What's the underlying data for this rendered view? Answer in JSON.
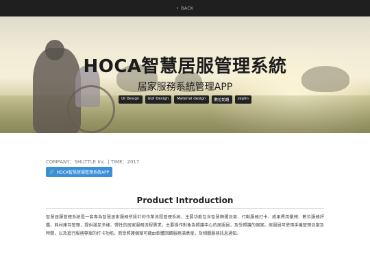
{
  "topbar": {
    "back_label": "BACK"
  },
  "hero": {
    "title": "HOCA智慧居服管理系統",
    "subtitle": "居家服務系統管理APP",
    "tags": [
      "UI Design",
      "GUI Design",
      "Material design",
      "數位訪題",
      "zeplin"
    ]
  },
  "meta": {
    "text": "COMPANY：SHUTTLE Inc. | TIME：2017"
  },
  "project_link": {
    "label": "HOCA智慧居服管理系統APP"
  },
  "section": {
    "title": "Product Introduction",
    "body": "智慧居服管理系統是一套專為智慧居家服務所設計的作業流程管理系統，主要功能包含智慧篩選派案、行動服務打卡、成果費用彙總、數位服務評鑑、耗材庫存管理，提供滿足多樣、彈性的居家服務流程需求。主要操作對象為照護中心的居服員，及受照護的個案。居服員可使用手機管理派案及時間，以及進行服務專案的打卡功能。而受照護個案可藉由軟體回饋服務滿意度，及相關服務訊息通知。"
  },
  "colors": {
    "topbar": "#1f1f1f",
    "link_button": "#3b8fd8",
    "tag_bg": "#222222"
  }
}
